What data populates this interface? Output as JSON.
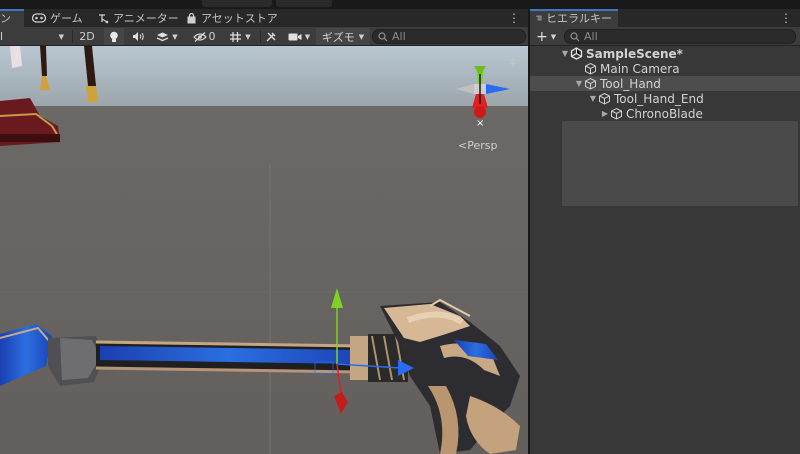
{
  "scene_tabs": [
    {
      "label": "ン",
      "icon": "scene-icon",
      "active": true
    },
    {
      "label": "ゲーム",
      "icon": "game-controller-icon",
      "active": false
    },
    {
      "label": "アニメーター",
      "icon": "animator-icon",
      "active": false
    },
    {
      "label": "アセットストア",
      "icon": "shopping-bag-icon",
      "active": false
    }
  ],
  "scene_toolbar": {
    "draw_mode_value": "l",
    "mode_2d": "2D",
    "hidden_count": "0",
    "gizmos_label": "ギズモ",
    "search_placeholder": "All"
  },
  "viewport": {
    "persp_label": "Persp"
  },
  "hierarchy": {
    "tab_label": "ヒエラルキー",
    "add_label": "+",
    "search_placeholder": "All",
    "items": [
      {
        "label": "SampleScene*",
        "depth": 0,
        "fold": "open",
        "icon": "unity-scene-icon",
        "bold": true,
        "selected": false
      },
      {
        "label": "Main Camera",
        "depth": 1,
        "fold": "none",
        "icon": "gameobject-cube-icon",
        "bold": false,
        "selected": false
      },
      {
        "label": "Tool_Hand",
        "depth": 1,
        "fold": "open",
        "icon": "gameobject-cube-icon",
        "bold": false,
        "selected": true
      },
      {
        "label": "Tool_Hand_End",
        "depth": 2,
        "fold": "open",
        "icon": "gameobject-cube-icon",
        "bold": false,
        "selected": false
      },
      {
        "label": "ChronoBlade",
        "depth": 3,
        "fold": "closed",
        "icon": "gameobject-cube-icon",
        "bold": false,
        "selected": false
      }
    ]
  },
  "colors": {
    "accent_tab": "#3a79bb",
    "gizmo_y": "#7ed321",
    "gizmo_x": "#e02020",
    "gizmo_z": "#2a6cf0",
    "sky": "#a9b9c7"
  }
}
